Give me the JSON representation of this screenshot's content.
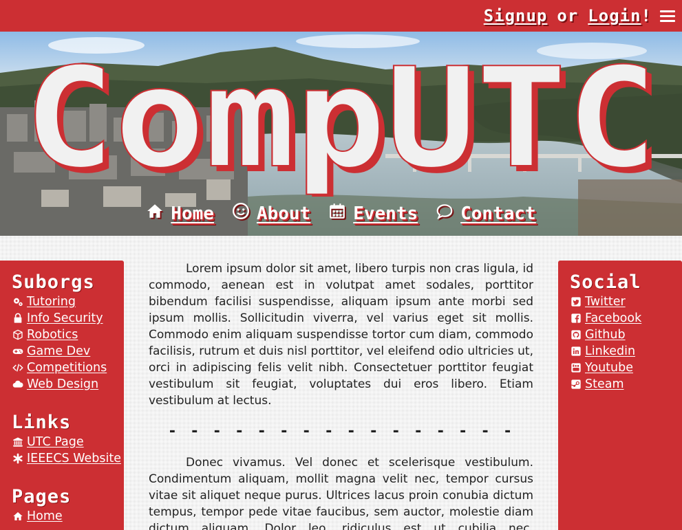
{
  "topbar": {
    "signup_label": "Signup",
    "or_text": "or",
    "login_label": "Login",
    "bang": "!",
    "menu_icon": "hamburger-icon"
  },
  "banner": {
    "logo_text": "CompUTC",
    "nav": [
      {
        "label": "Home",
        "icon": "home-icon"
      },
      {
        "label": "About",
        "icon": "smile-icon"
      },
      {
        "label": "Events",
        "icon": "calendar-icon"
      },
      {
        "label": "Contact",
        "icon": "speech-bubble-icon"
      }
    ]
  },
  "left_sidebar": {
    "suborgs": {
      "title": "Suborgs",
      "items": [
        {
          "label": "Tutoring",
          "icon": "gears-icon"
        },
        {
          "label": "Info Security",
          "icon": "lock-icon"
        },
        {
          "label": "Robotics",
          "icon": "cube-icon"
        },
        {
          "label": "Game Dev",
          "icon": "gamepad-icon"
        },
        {
          "label": "Competitions",
          "icon": "code-icon"
        },
        {
          "label": "Web Design",
          "icon": "cloud-icon"
        }
      ]
    },
    "links": {
      "title": "Links",
      "items": [
        {
          "label": "UTC Page",
          "icon": "university-icon"
        },
        {
          "label": "IEEECS Website",
          "icon": "asterisk-icon"
        }
      ]
    },
    "pages": {
      "title": "Pages",
      "items": [
        {
          "label": "Home",
          "icon": "home-icon"
        }
      ]
    }
  },
  "right_sidebar": {
    "social": {
      "title": "Social",
      "items": [
        {
          "label": "Twitter",
          "icon": "twitter-icon"
        },
        {
          "label": "Facebook",
          "icon": "facebook-icon"
        },
        {
          "label": "Github",
          "icon": "github-icon"
        },
        {
          "label": "Linkedin",
          "icon": "linkedin-icon"
        },
        {
          "label": "Youtube",
          "icon": "youtube-icon"
        },
        {
          "label": "Steam",
          "icon": "steam-icon"
        }
      ]
    }
  },
  "main": {
    "paragraph1": "Lorem ipsum dolor sit amet, libero turpis non cras ligula, id commodo, aenean est in volutpat amet sodales, porttitor bibendum facilisi suspendisse, aliquam ipsum ante morbi sed ipsum mollis. Sollicitudin viverra, vel varius eget sit mollis. Commodo enim aliquam suspendisse tortor cum diam, commodo facilisis, rutrum et duis nisl porttitor, vel eleifend odio ultricies ut, orci in adipiscing felis velit nibh. Consectetuer porttitor feugiat vestibulum sit feugiat, voluptates dui eros libero. Etiam vestibulum at lectus.",
    "divider": "- - - - - - - - - - - - - - - -",
    "paragraph2": "Donec vivamus. Vel donec et scelerisque vestibulum. Condimentum aliquam, mollit magna velit nec, tempor cursus vitae sit aliquet neque purus. Ultrices lacus proin conubia dictum tempus, tempor pede vitae faucibus, sem auctor, molestie diam dictum aliquam. Dolor leo, ridiculus est ut cubilia nec, fermentum"
  },
  "colors": {
    "brand_red": "#cc2f33",
    "dark_red": "#7a1012",
    "text": "#222222",
    "white": "#ffffff"
  }
}
